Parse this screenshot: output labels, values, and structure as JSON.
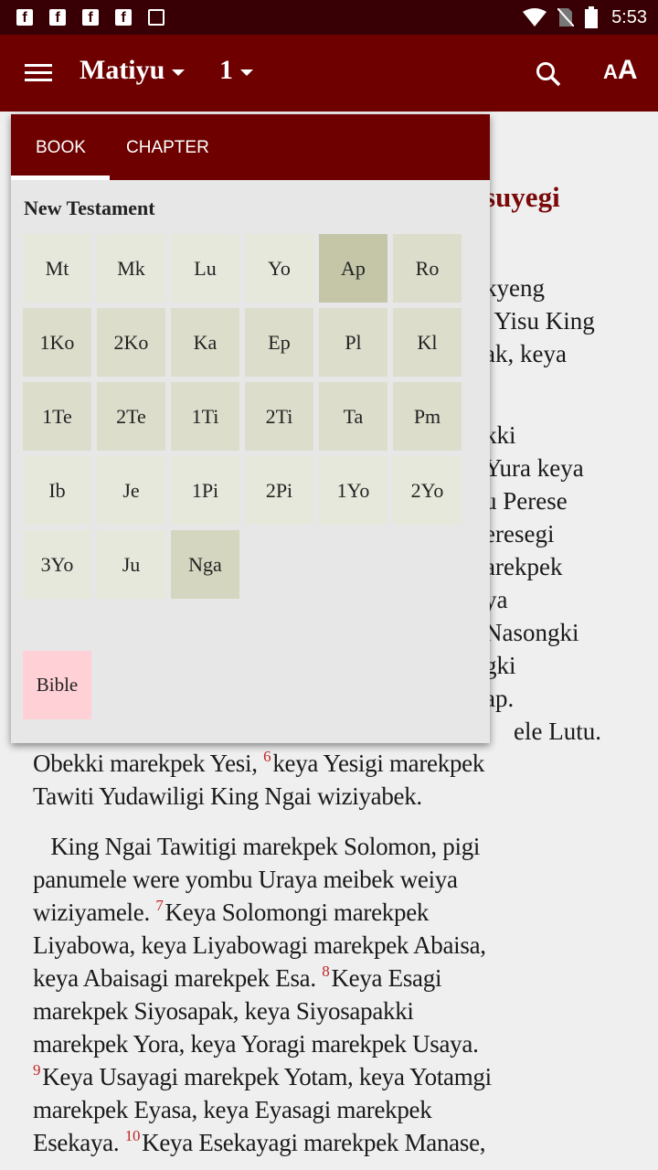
{
  "status": {
    "time": "5:53",
    "icons": [
      "facebook-icon",
      "facebook-icon",
      "facebook-icon",
      "facebook-icon",
      "image-icon",
      "wifi-icon",
      "no-sim-icon",
      "battery-icon"
    ]
  },
  "appbar": {
    "book": "Matiyu",
    "chapter": "1",
    "text_size_label": "AA"
  },
  "colors": {
    "appbar": "#6e0000",
    "status": "#380004",
    "verse_number": "#c0262b",
    "heading": "#7a0a0a",
    "bible_button": "#ffd0d6"
  },
  "popup": {
    "tabs": [
      {
        "label": "BOOK",
        "active": true
      },
      {
        "label": "CHAPTER",
        "active": false
      }
    ],
    "section": "New Testament",
    "books": [
      {
        "l": "Mt",
        "s": "light"
      },
      {
        "l": "Mk",
        "s": "light"
      },
      {
        "l": "Lu",
        "s": "light"
      },
      {
        "l": "Yo",
        "s": "light"
      },
      {
        "l": "Ap",
        "s": "dark"
      },
      {
        "l": "Ro",
        "s": ""
      },
      {
        "l": "1Ko",
        "s": ""
      },
      {
        "l": "2Ko",
        "s": ""
      },
      {
        "l": "Ka",
        "s": ""
      },
      {
        "l": "Ep",
        "s": ""
      },
      {
        "l": "Pl",
        "s": ""
      },
      {
        "l": "Kl",
        "s": ""
      },
      {
        "l": "1Te",
        "s": ""
      },
      {
        "l": "2Te",
        "s": ""
      },
      {
        "l": "1Ti",
        "s": ""
      },
      {
        "l": "2Ti",
        "s": ""
      },
      {
        "l": "Ta",
        "s": ""
      },
      {
        "l": "Pm",
        "s": ""
      },
      {
        "l": "Ib",
        "s": "light"
      },
      {
        "l": "Je",
        "s": "light"
      },
      {
        "l": "1Pi",
        "s": "light"
      },
      {
        "l": "2Pi",
        "s": "light"
      },
      {
        "l": "1Yo",
        "s": "light"
      },
      {
        "l": "2Yo",
        "s": "light"
      },
      {
        "l": "3Yo",
        "s": "light"
      },
      {
        "l": "Ju",
        "s": "light"
      },
      {
        "l": "Nga",
        "s": "mid"
      }
    ],
    "bible_button": "Bible"
  },
  "content": {
    "heading_fragment": "suyegi",
    "fragments": [
      "kyeng",
      ". Yisu King",
      "ak, keya",
      "kki",
      "Yura keya",
      "u Perese",
      "eresegi",
      "arekpek",
      "ya",
      "Nasongki",
      "gki",
      "ap.",
      "ele Lutu."
    ],
    "lines": [
      [
        {
          "t": "Obekki marekpek Yesi, "
        },
        {
          "v": "6"
        },
        {
          "t": "keya Yesigi marekpek"
        }
      ],
      [
        {
          "t": "Tawiti Yudawiligi King Ngai wiziyabek."
        }
      ],
      [
        {
          "t": "   King Ngai Tawitigi marekpek Solomon, pigi"
        }
      ],
      [
        {
          "t": "panumele were yombu Uraya meibek weiya"
        }
      ],
      [
        {
          "t": "wiziyamele. "
        },
        {
          "v": "7"
        },
        {
          "t": "Keya Solomongi marekpek"
        }
      ],
      [
        {
          "t": "Liyabowa, keya Liyabowagi marekpek Abaisa,"
        }
      ],
      [
        {
          "t": "keya Abaisagi marekpek Esa. "
        },
        {
          "v": "8"
        },
        {
          "t": "Keya Esagi"
        }
      ],
      [
        {
          "t": "marekpek Siyosapak, keya Siyosapakki"
        }
      ],
      [
        {
          "t": "marekpek Yora, keya Yoragi marekpek Usaya."
        }
      ],
      [
        {
          "v": "9"
        },
        {
          "t": "Keya Usayagi marekpek Yotam, keya Yotamgi"
        }
      ],
      [
        {
          "t": "marekpek Eyasa, keya Eyasagi marekpek"
        }
      ],
      [
        {
          "t": "Esekaya. "
        },
        {
          "v": "10"
        },
        {
          "t": "Keya Esekayagi marekpek Manase,"
        }
      ]
    ]
  }
}
